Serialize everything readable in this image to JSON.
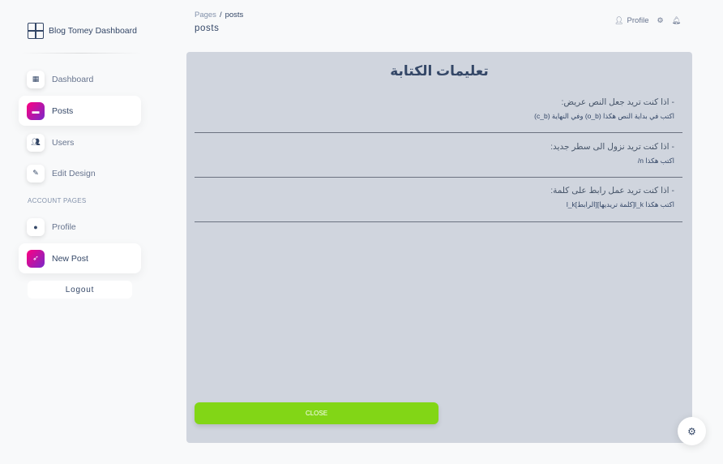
{
  "brand": {
    "name": "Blog Tomey Dashboard",
    "icon": "grid-logo-icon"
  },
  "sidebar": {
    "items": [
      {
        "label": "Dashboard",
        "icon": "shop-icon",
        "active": false
      },
      {
        "label": "Posts",
        "icon": "card-icon",
        "active": true
      },
      {
        "label": "Users",
        "icon": "users-icon",
        "active": false
      },
      {
        "label": "Edit Design",
        "icon": "edit-icon",
        "active": false
      }
    ],
    "section_label": "ACCOUNT PAGES",
    "account_items": [
      {
        "label": "Profile",
        "icon": "user-icon",
        "active": false
      },
      {
        "label": "New Post",
        "icon": "rocket-icon",
        "active": true
      }
    ],
    "logout_label": "Logout"
  },
  "header": {
    "breadcrumb_parent": "Pages",
    "breadcrumb_sep": "/",
    "breadcrumb_current": "posts",
    "title": "posts",
    "profile_label": "Profile"
  },
  "panel": {
    "title": "تعليمات الكتابة",
    "rules": [
      {
        "head": "- اذا كنت تريد جعل النص عريض:",
        "body": "اكتب في بداية النص هكذا (o_b) وفي النهاية (c_b)"
      },
      {
        "head": "- اذا كنت تريد نزول الى سطر جديد:",
        "body": "اكتب هكذا n/"
      },
      {
        "head": "- اذا كنت تريد عمل رابط على كلمة:",
        "body": "اكتب هكذا l_k[كلمة تريديها][الرابط]l_k"
      }
    ],
    "close_label": "CLOSE"
  },
  "colors": {
    "accent_gradient_start": "#7928ca",
    "accent_gradient_end": "#ff0080",
    "close_button": "#82d616",
    "panel_bg": "#d0d5de"
  }
}
